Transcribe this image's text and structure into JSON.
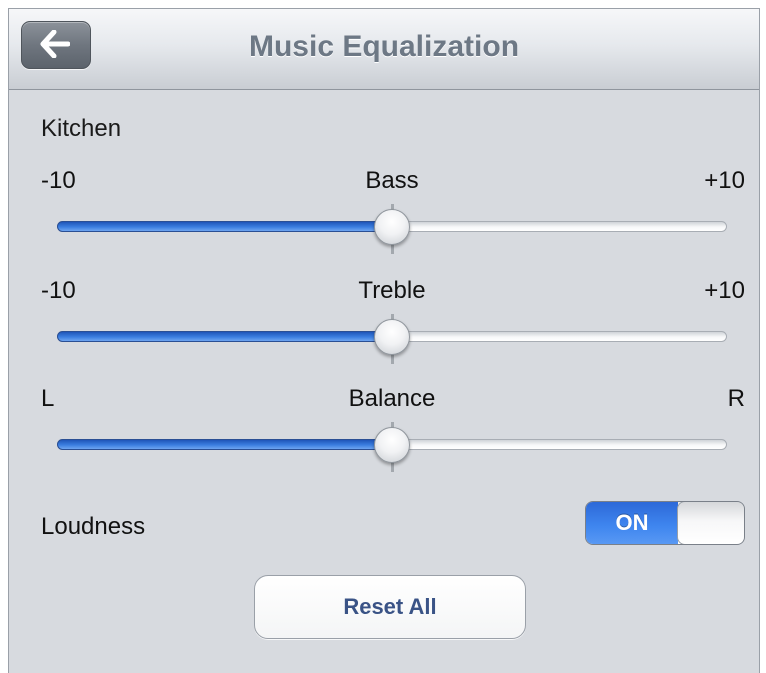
{
  "header": {
    "title": "Music Equalization",
    "back_icon": "arrow-left-icon"
  },
  "zone": "Kitchen",
  "sliders": {
    "bass": {
      "label": "Bass",
      "min_label": "-10",
      "max_label": "+10",
      "min": -10,
      "max": 10,
      "value": 0
    },
    "treble": {
      "label": "Treble",
      "min_label": "-10",
      "max_label": "+10",
      "min": -10,
      "max": 10,
      "value": 0
    },
    "balance": {
      "label": "Balance",
      "min_label": "L",
      "max_label": "R",
      "min": -10,
      "max": 10,
      "value": 0
    }
  },
  "loudness": {
    "label": "Loudness",
    "state_label": "ON",
    "on": true
  },
  "reset_label": "Reset All",
  "colors": {
    "accent_blue": "#3b7ee0",
    "background": "#d7dadf",
    "title_text": "#6d7885",
    "reset_text": "#3a5386"
  }
}
